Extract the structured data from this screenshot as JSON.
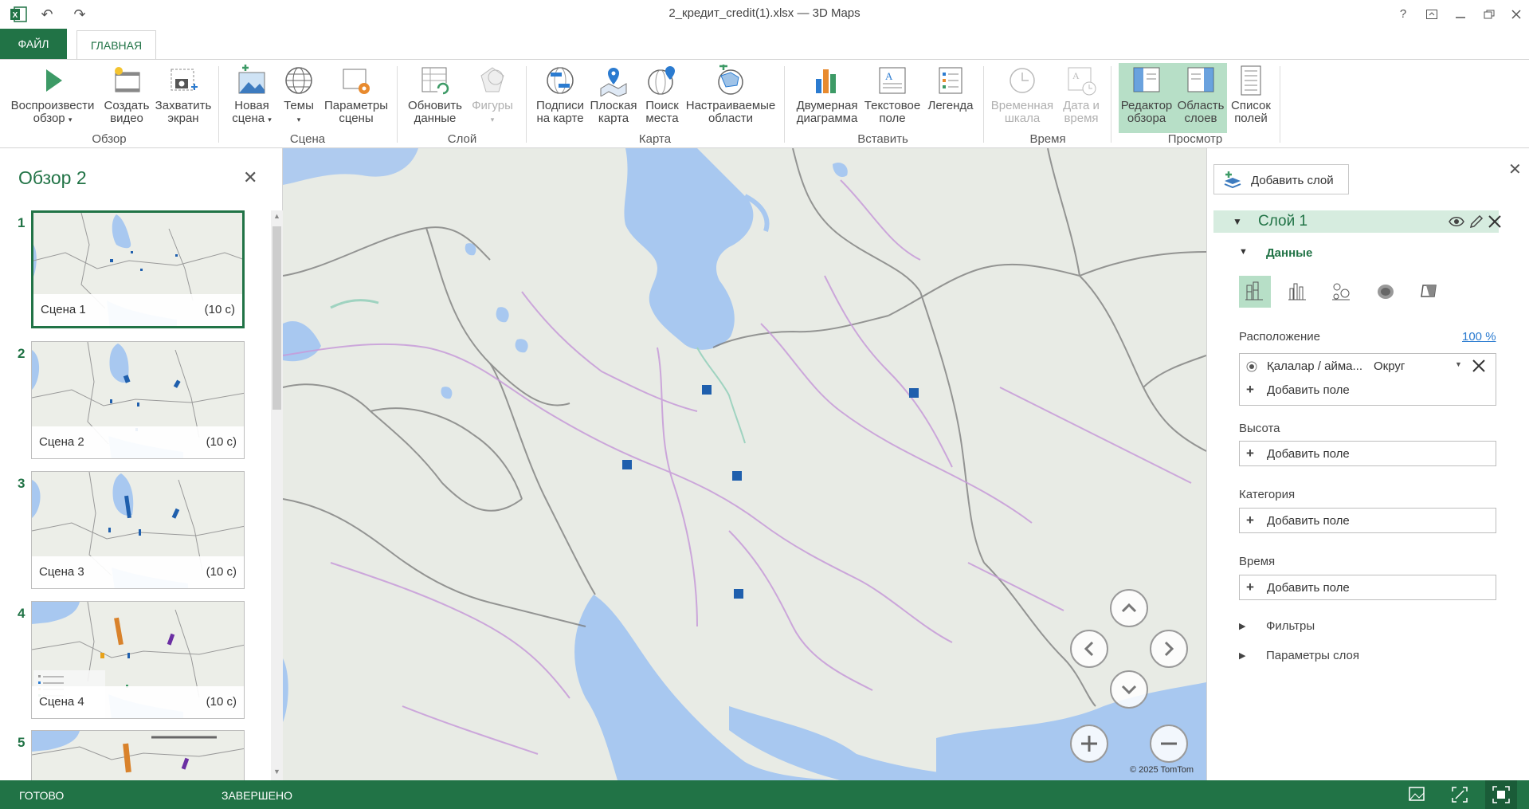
{
  "window": {
    "title": "2_кредит_credit(1).xlsx — 3D Maps",
    "icons": [
      "excel-logo",
      "undo-icon",
      "redo-icon",
      "help-icon",
      "ribbon-display-icon",
      "minimize-icon",
      "restore-icon",
      "close-icon"
    ]
  },
  "tabs": {
    "file": "ФАЙЛ",
    "home": "ГЛАВНАЯ"
  },
  "ribbon": {
    "groups": {
      "tour": "Обзор",
      "scene": "Сцена",
      "layer": "Слой",
      "map": "Карта",
      "insert": "Вставить",
      "time": "Время",
      "view": "Просмотр"
    },
    "buttons": {
      "play_tour": [
        "Воспроизвести",
        "обзор"
      ],
      "create_video": [
        "Создать",
        "видео"
      ],
      "capture_screen": [
        "Захватить",
        "экран"
      ],
      "new_scene": [
        "Новая",
        "сцена"
      ],
      "themes": [
        "Темы",
        ""
      ],
      "scene_options": [
        "Параметры",
        "сцены"
      ],
      "refresh_data": [
        "Обновить",
        "данные"
      ],
      "shapes": [
        "Фигуры",
        ""
      ],
      "map_labels": [
        "Подписи",
        "на карте"
      ],
      "flat_map": [
        "Плоская",
        "карта"
      ],
      "find_location": [
        "Поиск",
        "места"
      ],
      "custom_regions": [
        "Настраиваемые",
        "области"
      ],
      "chart_2d": [
        "Двумерная",
        "диаграмма"
      ],
      "text_box": [
        "Текстовое",
        "поле"
      ],
      "legend": [
        "Легенда",
        ""
      ],
      "time_line": [
        "Временная",
        "шкала"
      ],
      "date_time": [
        "Дата и",
        "время"
      ],
      "tour_editor": [
        "Редактор",
        "обзора"
      ],
      "layer_pane": [
        "Область",
        "слоев"
      ],
      "field_list": [
        "Список",
        "полей"
      ]
    },
    "disabled": [
      "shapes",
      "time_line",
      "date_time"
    ],
    "toggled": [
      "tour_editor",
      "layer_pane"
    ]
  },
  "tour": {
    "title": "Обзор 2",
    "scenes": [
      {
        "number": "1",
        "name": "Сцена 1",
        "duration": "(10 с)",
        "selected": true
      },
      {
        "number": "2",
        "name": "Сцена 2",
        "duration": "(10 с)",
        "selected": false
      },
      {
        "number": "3",
        "name": "Сцена 3",
        "duration": "(10 с)",
        "selected": false
      },
      {
        "number": "4",
        "name": "Сцена 4",
        "duration": "(10 с)",
        "selected": false
      },
      {
        "number": "5",
        "name": "",
        "duration": "",
        "selected": false
      }
    ]
  },
  "map": {
    "copyright": "© 2025 TomTom",
    "point_color": "#1f5fad",
    "data_points": 5,
    "navigation": [
      "tilt-up-button",
      "rotate-left-button",
      "rotate-right-button",
      "tilt-down-button",
      "zoom-in-button",
      "zoom-out-button"
    ]
  },
  "layer_pane": {
    "add_layer": "Добавить слой",
    "layer_name": "Слой 1",
    "data_section": "Данные",
    "viz_types": [
      "stacked-column-icon",
      "clustered-column-icon",
      "bubble-icon",
      "heat-map-icon",
      "region-icon"
    ],
    "selected_viz": "stacked-column-icon",
    "location": {
      "label": "Расположение",
      "percent": "100 %",
      "field": "Қалалар / аймa...",
      "field_type": "Округ",
      "add_field": "Добавить поле"
    },
    "height": {
      "label": "Высота",
      "add_field": "Добавить поле"
    },
    "category": {
      "label": "Категория",
      "add_field": "Добавить поле"
    },
    "time": {
      "label": "Время",
      "add_field": "Добавить поле"
    },
    "filters": "Фильтры",
    "layer_options": "Параметры слоя"
  },
  "status": {
    "left": "ГОТОВО",
    "middle": "ЗАВЕРШЕНО",
    "icons": [
      "scene-view-icon",
      "fit-view-icon",
      "full-screen-icon"
    ]
  },
  "colors": {
    "accent": "#217346",
    "selected_bg": "#b7dfc7",
    "water": "#a8c8f0",
    "land": "#e8ebe5"
  }
}
